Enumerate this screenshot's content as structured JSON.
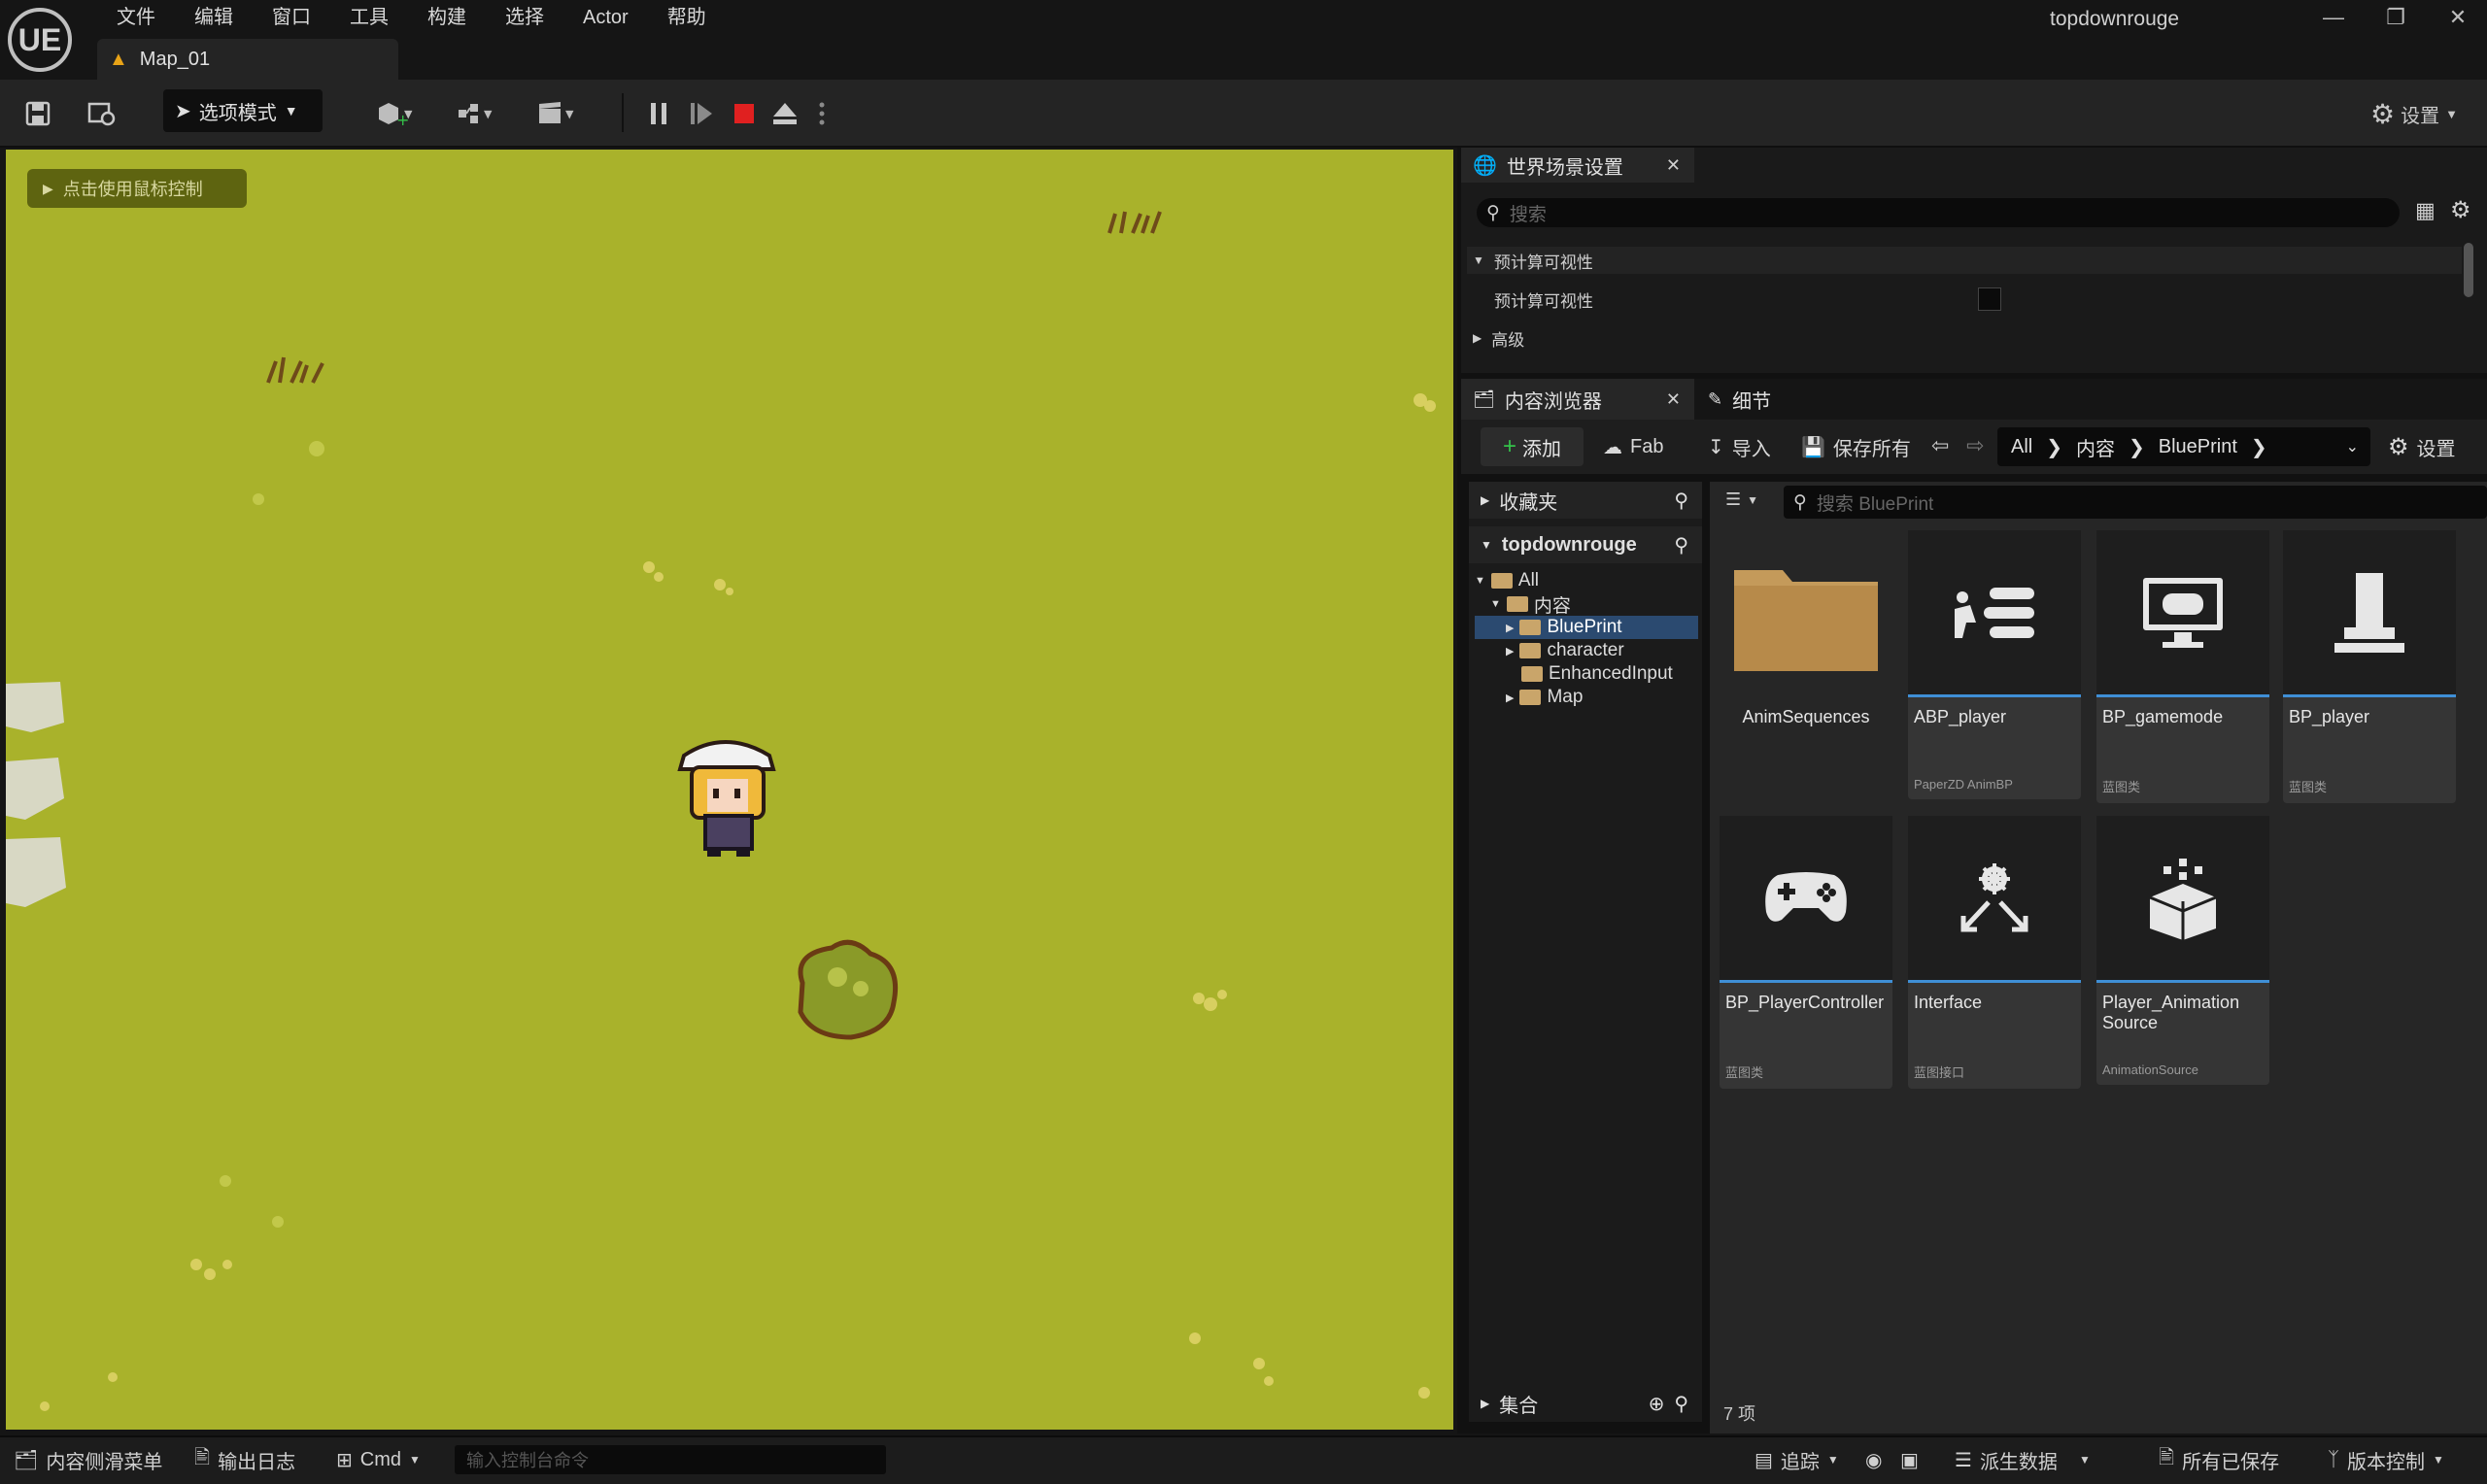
{
  "titlebar": {
    "logo": "UE",
    "menu": [
      "文件",
      "编辑",
      "窗口",
      "工具",
      "构建",
      "选择",
      "Actor",
      "帮助"
    ],
    "project_name": "topdownrouge",
    "map_tab": "Map_01"
  },
  "toolbar": {
    "mode_label": "选项模式",
    "settings_label": "设置"
  },
  "viewport": {
    "hint": "点击使用鼠标控制"
  },
  "world_settings": {
    "tab_label": "世界场景设置",
    "search_placeholder": "搜索",
    "section": "预计算可视性",
    "property": "预计算可视性",
    "advanced": "高级"
  },
  "content_browser": {
    "tab_label": "内容浏览器",
    "details_tab": "细节",
    "add_label": "添加",
    "fab_label": "Fab",
    "import_label": "导入",
    "save_all_label": "保存所有",
    "settings_label": "设置",
    "breadcrumbs": [
      "All",
      "内容",
      "BluePrint"
    ],
    "favorites": "收藏夹",
    "project_root": "topdownrouge",
    "tree": {
      "all": "All",
      "content": "内容",
      "blueprint": "BluePrint",
      "character": "character",
      "enhanced_input": "EnhancedInput",
      "map": "Map"
    },
    "collections": "集合",
    "search_placeholder": "搜索 BluePrint",
    "item_count": "7 项",
    "assets": [
      {
        "name": "AnimSequences",
        "type": ""
      },
      {
        "name": "ABP_player",
        "type": "PaperZD AnimBP"
      },
      {
        "name": "BP_gamemode",
        "type": "蓝图类"
      },
      {
        "name": "BP_player",
        "type": "蓝图类"
      },
      {
        "name": "BP_PlayerController",
        "type": "蓝图类"
      },
      {
        "name": "Interface",
        "type": "蓝图接口"
      },
      {
        "name": "Player_Animation Source",
        "type": "AnimationSource"
      }
    ]
  },
  "statusbar": {
    "content_drawer": "内容侧滑菜单",
    "output_log": "输出日志",
    "cmd": "Cmd",
    "cmd_placeholder": "输入控制台命令",
    "trace": "追踪",
    "derived_data": "派生数据",
    "all_saved": "所有已保存",
    "source_control": "版本控制"
  }
}
